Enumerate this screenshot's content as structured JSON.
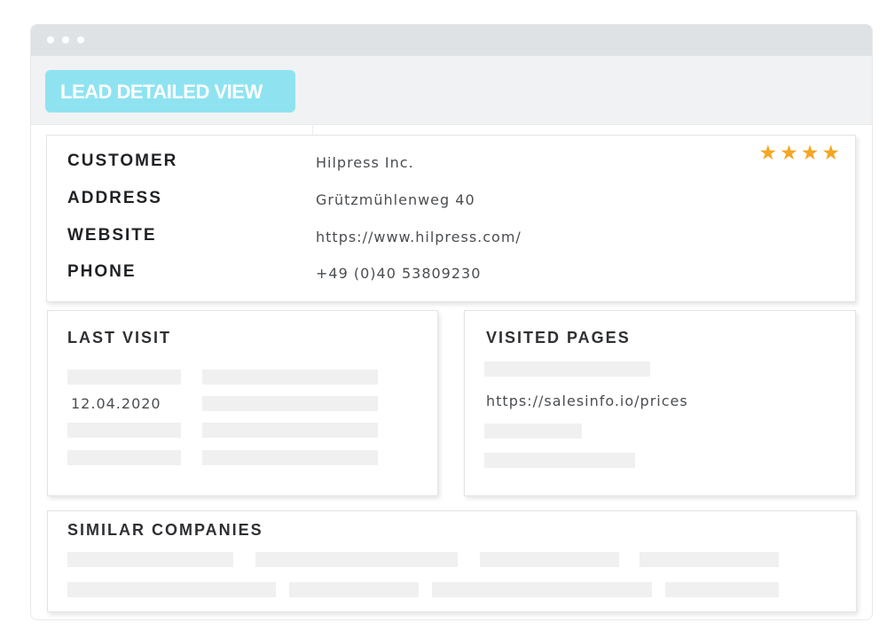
{
  "header": {
    "lead_button_label": "LEAD DETAILED VIEW"
  },
  "customer": {
    "rating_stars": 4,
    "stars_text": "★★★★",
    "fields": [
      {
        "label": "CUSTOMER",
        "value": "Hilpress Inc."
      },
      {
        "label": "ADDRESS",
        "value": "Grützmühlenweg 40"
      },
      {
        "label": "WEBSITE",
        "value": "https://www.hilpress.com/"
      },
      {
        "label": "PHONE",
        "value": "+49 (0)40 53809230"
      }
    ]
  },
  "last_visit": {
    "title": "LAST VISIT",
    "date": "12.04.2020"
  },
  "visited_pages": {
    "title": "VISITED PAGES",
    "url": "https://salesinfo.io/prices"
  },
  "similar_companies": {
    "title": "SIMILAR COMPANIES"
  },
  "colors": {
    "accent": "#8fe3f1",
    "star": "#f5a623",
    "placeholder": "#f0f0f1"
  }
}
